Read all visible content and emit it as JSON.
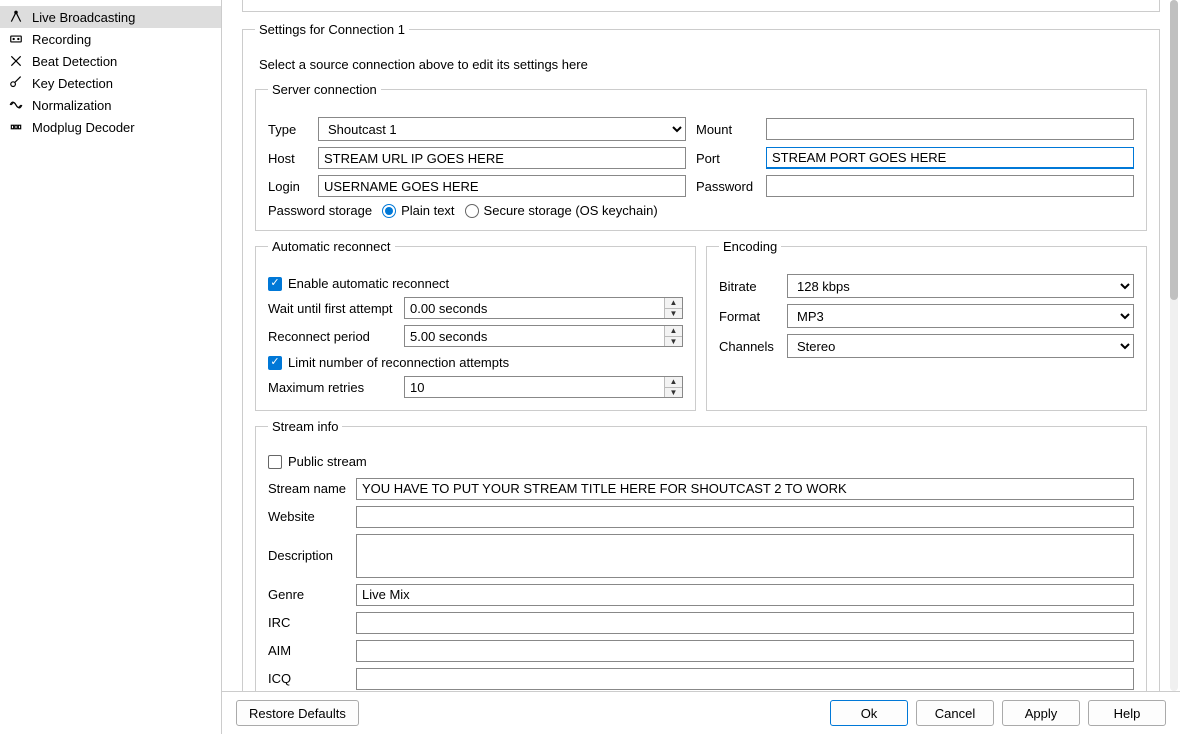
{
  "sidebar": {
    "items": [
      {
        "label": "Live Broadcasting",
        "icon": "broadcast-icon",
        "selected": true
      },
      {
        "label": "Recording",
        "icon": "record-icon"
      },
      {
        "label": "Beat Detection",
        "icon": "beat-icon"
      },
      {
        "label": "Key Detection",
        "icon": "key-icon"
      },
      {
        "label": "Normalization",
        "icon": "normalize-icon"
      },
      {
        "label": "Modplug Decoder",
        "icon": "decoder-icon"
      }
    ]
  },
  "settings_group_title": "Settings for Connection 1",
  "help_text": "Select a source connection above to edit its settings here",
  "server": {
    "legend": "Server connection",
    "labels": {
      "type": "Type",
      "host": "Host",
      "login": "Login",
      "mount": "Mount",
      "port": "Port",
      "password": "Password"
    },
    "type": "Shoutcast 1",
    "host": "STREAM URL IP GOES HERE",
    "login": "USERNAME GOES HERE",
    "mount": "",
    "port": "STREAM PORT GOES HERE",
    "password": "",
    "pw_storage_label": "Password storage",
    "pw_plain": "Plain text",
    "pw_secure": "Secure storage (OS keychain)"
  },
  "auto": {
    "legend": "Automatic reconnect",
    "enable_label": "Enable automatic reconnect",
    "wait_label": "Wait until first attempt",
    "wait_value": "0.00 seconds",
    "period_label": "Reconnect period",
    "period_value": "5.00 seconds",
    "limit_label": "Limit number of reconnection attempts",
    "max_label": "Maximum retries",
    "max_value": "10"
  },
  "encoding": {
    "legend": "Encoding",
    "bitrate_label": "Bitrate",
    "bitrate_value": "128 kbps",
    "format_label": "Format",
    "format_value": "MP3",
    "channels_label": "Channels",
    "channels_value": "Stereo"
  },
  "stream": {
    "legend": "Stream info",
    "public_label": "Public stream",
    "name_label": "Stream name",
    "name_value": "YOU HAVE TO PUT YOUR STREAM TITLE HERE FOR SHOUTCAST 2 TO WORK",
    "website_label": "Website",
    "website_value": "",
    "description_label": "Description",
    "description_value": "",
    "genre_label": "Genre",
    "genre_value": "Live Mix",
    "irc_label": "IRC",
    "irc_value": "",
    "aim_label": "AIM",
    "aim_value": "",
    "icq_label": "ICQ",
    "icq_value": ""
  },
  "footer": {
    "restore": "Restore Defaults",
    "ok": "Ok",
    "cancel": "Cancel",
    "apply": "Apply",
    "help": "Help"
  }
}
